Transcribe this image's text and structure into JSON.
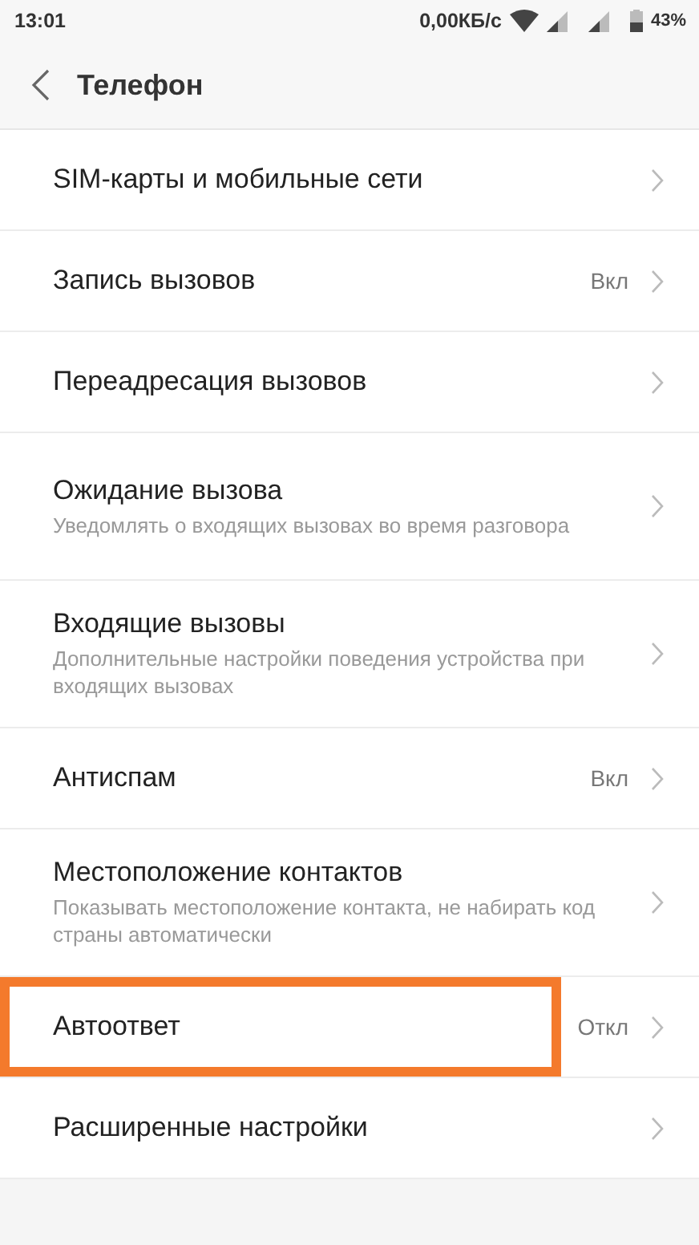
{
  "status_bar": {
    "time": "13:01",
    "speed": "0,00КБ/с",
    "battery": "43%"
  },
  "header": {
    "title": "Телефон"
  },
  "items": [
    {
      "title": "SIM-карты и мобильные сети",
      "highlighted": false
    },
    {
      "title": "Запись вызовов",
      "value": "Вкл",
      "highlighted": false
    },
    {
      "title": "Переадресация вызовов",
      "highlighted": false
    },
    {
      "title": "Ожидание вызова",
      "subtitle": "Уведомлять о входящих вызовах во время разговора",
      "highlighted": false
    },
    {
      "title": "Входящие вызовы",
      "subtitle": "Дополнительные настройки поведения устройства при входящих вызовах",
      "highlighted": false
    },
    {
      "title": "Антиспам",
      "value": "Вкл",
      "highlighted": false
    },
    {
      "title": "Местоположение контактов",
      "subtitle": "Показывать местоположение контакта, не набирать код страны автоматически",
      "highlighted": false
    },
    {
      "title": "Автоответ",
      "value": "Откл",
      "highlighted": true
    },
    {
      "title": "Расширенные настройки",
      "highlighted": false
    }
  ]
}
